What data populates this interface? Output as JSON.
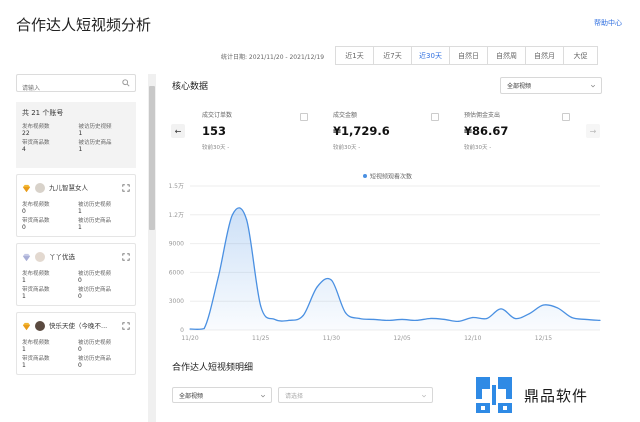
{
  "header": {
    "title": "合作达人短视频分析",
    "help": "帮助中心"
  },
  "date_bar": {
    "label": "统计日期: 2021/11/20 - 2021/12/19",
    "ranges": [
      "近1天",
      "近7天",
      "近30天",
      "自然日",
      "自然周",
      "自然月",
      "大促"
    ],
    "active": "近30天"
  },
  "sidebar": {
    "search_placeholder": "请输入",
    "summary": {
      "title": "共 21 个账号",
      "stats": [
        {
          "label": "发布视频数",
          "value": "22"
        },
        {
          "label": "被访历史视频",
          "value": "1"
        },
        {
          "label": "带货商品数",
          "value": "4"
        },
        {
          "label": "被访历史商品",
          "value": "1"
        }
      ]
    },
    "accounts": [
      {
        "name": "九儿智慧女人",
        "stats": [
          {
            "label": "发布视频数",
            "value": "0"
          },
          {
            "label": "被访历史视频",
            "value": "1"
          },
          {
            "label": "带货商品数",
            "value": "0"
          },
          {
            "label": "被访历史商品",
            "value": "1"
          }
        ]
      },
      {
        "name": "丫丫优选",
        "stats": [
          {
            "label": "发布视频数",
            "value": "1"
          },
          {
            "label": "被访历史视频",
            "value": "0"
          },
          {
            "label": "带货商品数",
            "value": "1"
          },
          {
            "label": "被访历史商品",
            "value": "0"
          }
        ]
      },
      {
        "name": "快乐天使（今晚不...",
        "stats": [
          {
            "label": "发布视频数",
            "value": "1"
          },
          {
            "label": "被访历史视频",
            "value": "0"
          },
          {
            "label": "带货商品数",
            "value": "1"
          },
          {
            "label": "被访历史商品",
            "value": "0"
          }
        ]
      }
    ]
  },
  "main": {
    "section_title": "核心数据",
    "video_select": "全部视频",
    "metrics": [
      {
        "label": "成交订单数",
        "value": "153",
        "compare": "较前30天 -"
      },
      {
        "label": "成交金额",
        "value": "¥1,729.6",
        "compare": "较前30天 -"
      },
      {
        "label": "预估佣金支出",
        "value": "¥86.67",
        "compare": "较前30天 -"
      }
    ],
    "section2_title": "合作达人短视频明细",
    "detail_select": "全部视频",
    "detail_placeholder": "请选择"
  },
  "chart_data": {
    "type": "line",
    "legend": [
      "短视频观看次数"
    ],
    "y_ticks": [
      "0",
      "3000",
      "6000",
      "9000",
      "1.2万",
      "1.5万"
    ],
    "x_ticks": [
      "11/20",
      "11/25",
      "11/30",
      "12/05",
      "12/10",
      "12/15"
    ],
    "ylim": [
      0,
      15000
    ],
    "x": [
      "11/20",
      "11/21",
      "11/22",
      "11/23",
      "11/24",
      "11/25",
      "11/26",
      "11/27",
      "11/28",
      "11/29",
      "11/30",
      "12/01",
      "12/02",
      "12/03",
      "12/04",
      "12/05",
      "12/06",
      "12/07",
      "12/08",
      "12/09",
      "12/10",
      "12/11",
      "12/12",
      "12/13",
      "12/14",
      "12/15",
      "12/16",
      "12/17",
      "12/18",
      "12/19"
    ],
    "series": [
      {
        "name": "短视频观看次数",
        "values": [
          100,
          150,
          5500,
          12000,
          11500,
          2500,
          1100,
          1000,
          1500,
          4500,
          5200,
          1800,
          1200,
          1100,
          1000,
          1100,
          1000,
          1200,
          1100,
          900,
          1300,
          1200,
          2200,
          1200,
          1700,
          2600,
          2300,
          1300,
          1100,
          1000
        ]
      }
    ],
    "color": "#4a90e2"
  },
  "watermark": {
    "text": "鼎品软件",
    "color": "#2f8ae5"
  }
}
